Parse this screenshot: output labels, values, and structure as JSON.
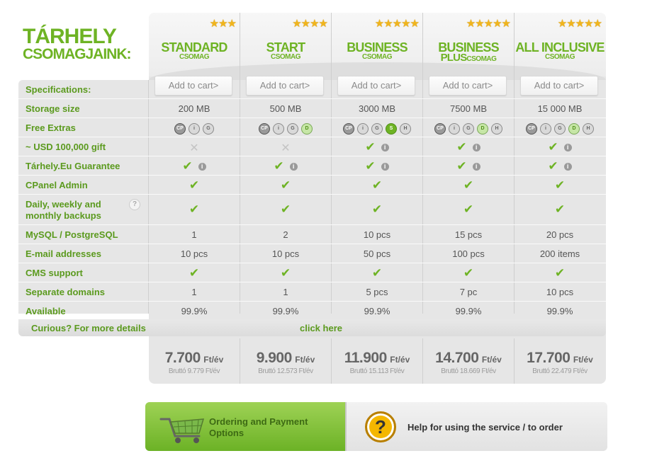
{
  "heading": {
    "line1": "TÁRHELY",
    "line2": "CSOMAGJAINK:"
  },
  "packages": [
    {
      "name": "STANDARD",
      "sub": "CSOMAG",
      "stars": "★★★",
      "rating": 3
    },
    {
      "name": "START",
      "sub": "CSOMAG",
      "stars": "★★★★",
      "rating": 4
    },
    {
      "name": "BUSINESS",
      "sub": "CSOMAG",
      "stars": "★★★★★",
      "rating": 5
    },
    {
      "name": "BUSINESS",
      "name2": "PLUS",
      "sub": "CSOMAG",
      "stars": "★★★★★",
      "rating": 5
    },
    {
      "name": "ALL INCLUSIVE",
      "sub": "CSOMAG",
      "stars": "★★★★★",
      "rating": 5
    }
  ],
  "cart_label": "Add to cart>",
  "rows": {
    "spec": "Specifications:",
    "storage": "Storage size",
    "extras": "Free Extras",
    "gift": "~ USD 100,000 gift",
    "guarantee": "Tárhely.Eu Guarantee",
    "cpanel": "CPanel Admin",
    "backup1": "Daily, weekly and",
    "backup2": "monthly backups",
    "mysql": "MySQL / PostgreSQL",
    "email": "E-mail addresses",
    "cms": "CMS support",
    "domains": "Separate domains",
    "available": "Available"
  },
  "values": {
    "storage": [
      "200 MB",
      "500 MB",
      "3000 MB",
      "7500 MB",
      "15 000 MB"
    ],
    "mysql": [
      "1",
      "2",
      "10 pcs",
      "15 pcs",
      "20 pcs"
    ],
    "email": [
      "10 pcs",
      "10 pcs",
      "50 pcs",
      "100 pcs",
      "200 items"
    ],
    "domains": [
      "1",
      "1",
      "5 pcs",
      "7 pc",
      "10 pcs"
    ],
    "available": [
      "99.9%",
      "99.9%",
      "99.9%",
      "99.9%",
      "99.9%"
    ]
  },
  "badges": {
    "cp": "CP",
    "i": "i",
    "g": "G",
    "d": "D",
    "s": "S",
    "h": "H"
  },
  "symbols": {
    "check": "✔",
    "cross": "✕",
    "info": "i",
    "question": "?"
  },
  "curious": {
    "text": "Curious? For more details",
    "link": "click here"
  },
  "prices": [
    {
      "value": "7.700",
      "unit": "Ft/év",
      "gross": "Bruttó 9.779 Ft/év"
    },
    {
      "value": "9.900",
      "unit": "Ft/év",
      "gross": "Bruttó 12.573 Ft/év"
    },
    {
      "value": "11.900",
      "unit": "Ft/év",
      "gross": "Bruttó 15.113 Ft/év"
    },
    {
      "value": "14.700",
      "unit": "Ft/év",
      "gross": "Bruttó 18.669 Ft/év"
    },
    {
      "value": "17.700",
      "unit": "Ft/év",
      "gross": "Bruttó 22.479 Ft/év"
    }
  ],
  "footer": {
    "ordering1": "Ordering and Payment",
    "ordering2": "Options",
    "help": "Help for using the service / to order",
    "help_symbol": "?"
  },
  "colors": {
    "green": "#6eb324",
    "star": "#f1b51c",
    "panel": "#e6e6e6"
  }
}
